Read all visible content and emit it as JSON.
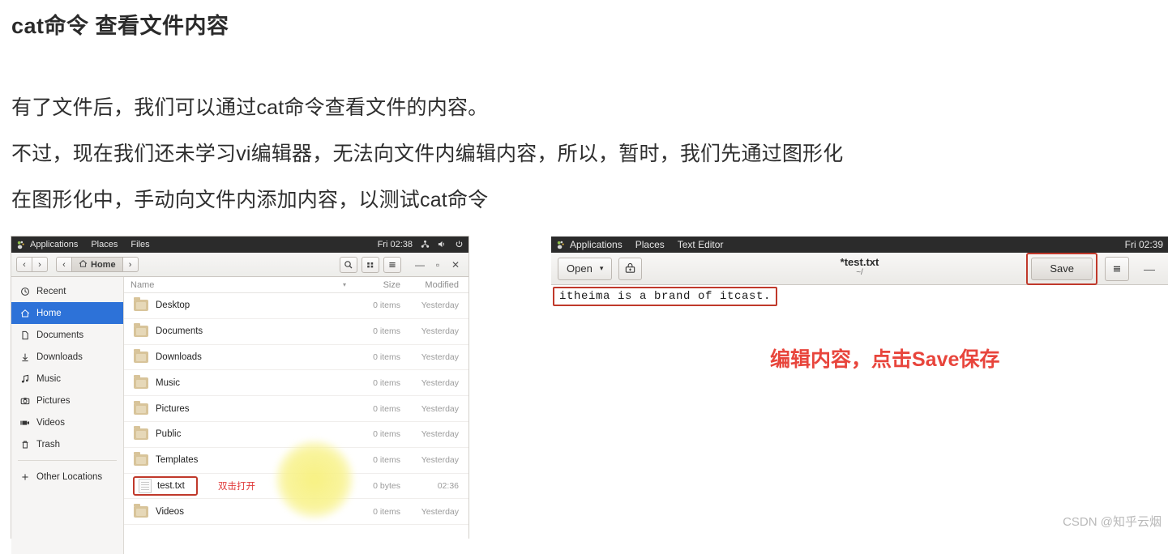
{
  "article": {
    "title": "cat命令 查看文件内容",
    "paragraphs": [
      "有了文件后，我们可以通过cat命令查看文件的内容。",
      "不过，现在我们还未学习vi编辑器，无法向文件内编辑内容，所以，暂时，我们先通过图形化",
      "在图形化中，手动向文件内添加内容，以测试cat命令"
    ]
  },
  "file_manager": {
    "topbar": {
      "applications": "Applications",
      "places": "Places",
      "app_name": "Files",
      "clock": "Fri 02:38",
      "icons": [
        "network-icon",
        "volume-icon",
        "power-icon"
      ]
    },
    "toolbar": {
      "back": "‹",
      "forward": "›",
      "crumb_prev": "‹",
      "crumb_home": "Home",
      "crumb_next": "›",
      "search": "search-icon",
      "grid_view": "grid-view-icon",
      "menu": "hamburger-icon",
      "minimize": "—",
      "maximize": "▫",
      "close": "✕"
    },
    "sidebar": [
      {
        "label": "Recent",
        "icon": "clock-icon",
        "active": false
      },
      {
        "label": "Home",
        "icon": "home-icon",
        "active": true
      },
      {
        "label": "Documents",
        "icon": "document-icon",
        "active": false
      },
      {
        "label": "Downloads",
        "icon": "download-icon",
        "active": false
      },
      {
        "label": "Music",
        "icon": "music-icon",
        "active": false
      },
      {
        "label": "Pictures",
        "icon": "camera-icon",
        "active": false
      },
      {
        "label": "Videos",
        "icon": "video-icon",
        "active": false
      },
      {
        "label": "Trash",
        "icon": "trash-icon",
        "active": false
      }
    ],
    "sidebar_other": {
      "label": "Other Locations",
      "icon": "plus-icon"
    },
    "columns": {
      "name": "Name",
      "size": "Size",
      "modified": "Modified",
      "sort_indicator": "▾"
    },
    "rows": [
      {
        "name": "Desktop",
        "type": "folder",
        "size": "0 items",
        "modified": "Yesterday",
        "selected": false,
        "annotation": ""
      },
      {
        "name": "Documents",
        "type": "folder",
        "size": "0 items",
        "modified": "Yesterday",
        "selected": false,
        "annotation": ""
      },
      {
        "name": "Downloads",
        "type": "folder",
        "size": "0 items",
        "modified": "Yesterday",
        "selected": false,
        "annotation": ""
      },
      {
        "name": "Music",
        "type": "folder",
        "size": "0 items",
        "modified": "Yesterday",
        "selected": false,
        "annotation": ""
      },
      {
        "name": "Pictures",
        "type": "folder",
        "size": "0 items",
        "modified": "Yesterday",
        "selected": false,
        "annotation": ""
      },
      {
        "name": "Public",
        "type": "folder",
        "size": "0 items",
        "modified": "Yesterday",
        "selected": false,
        "annotation": ""
      },
      {
        "name": "Templates",
        "type": "folder",
        "size": "0 items",
        "modified": "Yesterday",
        "selected": false,
        "annotation": ""
      },
      {
        "name": "test.txt",
        "type": "file",
        "size": "0 bytes",
        "modified": "02:36",
        "selected": true,
        "annotation": "双击打开"
      },
      {
        "name": "Videos",
        "type": "folder",
        "size": "0 items",
        "modified": "Yesterday",
        "selected": false,
        "annotation": ""
      }
    ]
  },
  "text_editor": {
    "topbar": {
      "applications": "Applications",
      "places": "Places",
      "app_name": "Text Editor",
      "clock": "Fri 02:39"
    },
    "toolbar": {
      "open_label": "Open",
      "open_caret": "▾",
      "new_doc_icon": "new-document-icon",
      "title": "*test.txt",
      "subtitle": "~/",
      "save_label": "Save",
      "menu_icon": "hamburger-icon",
      "minimize": "—"
    },
    "content": "itheima is a brand of itcast."
  },
  "annotations": {
    "save_note": "编辑内容，点击Save保存"
  },
  "watermark": "CSDN @知乎云烟",
  "colors": {
    "accent_blue": "#2d72d8",
    "annotation_red": "#e8453c",
    "highlight_box_red": "#c0392b",
    "cursor_glow": "#f7f078"
  }
}
